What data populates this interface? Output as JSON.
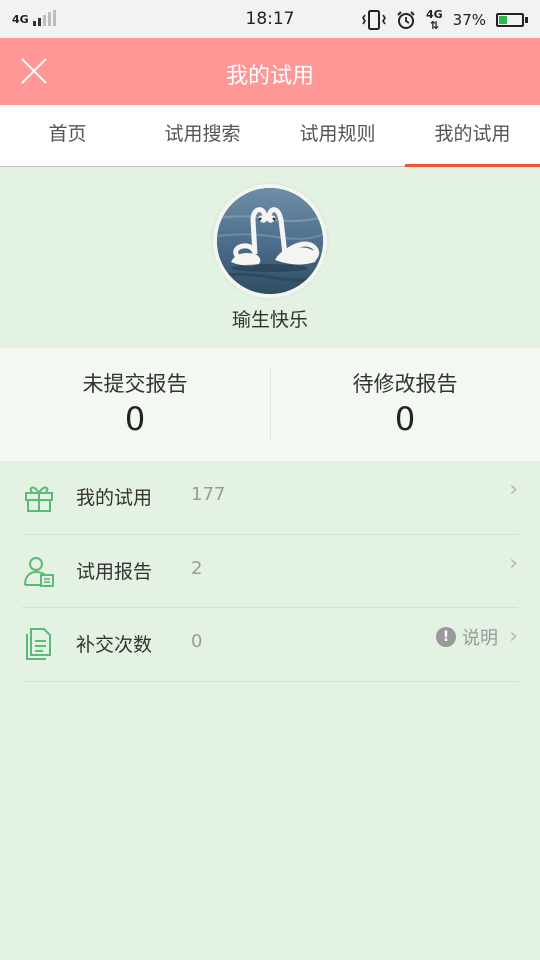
{
  "status_bar": {
    "network": "4G",
    "time": "18:17",
    "data_network": "4G",
    "battery_percent": "37%",
    "battery_level": 0.37
  },
  "header": {
    "title": "我的试用"
  },
  "tabs": [
    {
      "label": "首页"
    },
    {
      "label": "试用搜索"
    },
    {
      "label": "试用规则"
    },
    {
      "label": "我的试用",
      "active": true
    }
  ],
  "profile": {
    "username": "瑜生快乐"
  },
  "stats": {
    "unsubmitted": {
      "label": "未提交报告",
      "value": "0"
    },
    "to_revise": {
      "label": "待修改报告",
      "value": "0"
    }
  },
  "menu": [
    {
      "label": "我的试用",
      "count": "177",
      "icon": "gift-icon"
    },
    {
      "label": "试用报告",
      "count": "2",
      "icon": "user-report-icon"
    },
    {
      "label": "补交次数",
      "count": "0",
      "icon": "document-icon",
      "note": "说明"
    }
  ],
  "colors": {
    "header_bg": "#ff9797",
    "active_tab_underline": "#f0553b",
    "page_bg": "#e4f2e4",
    "icon_green": "#5cb978"
  }
}
